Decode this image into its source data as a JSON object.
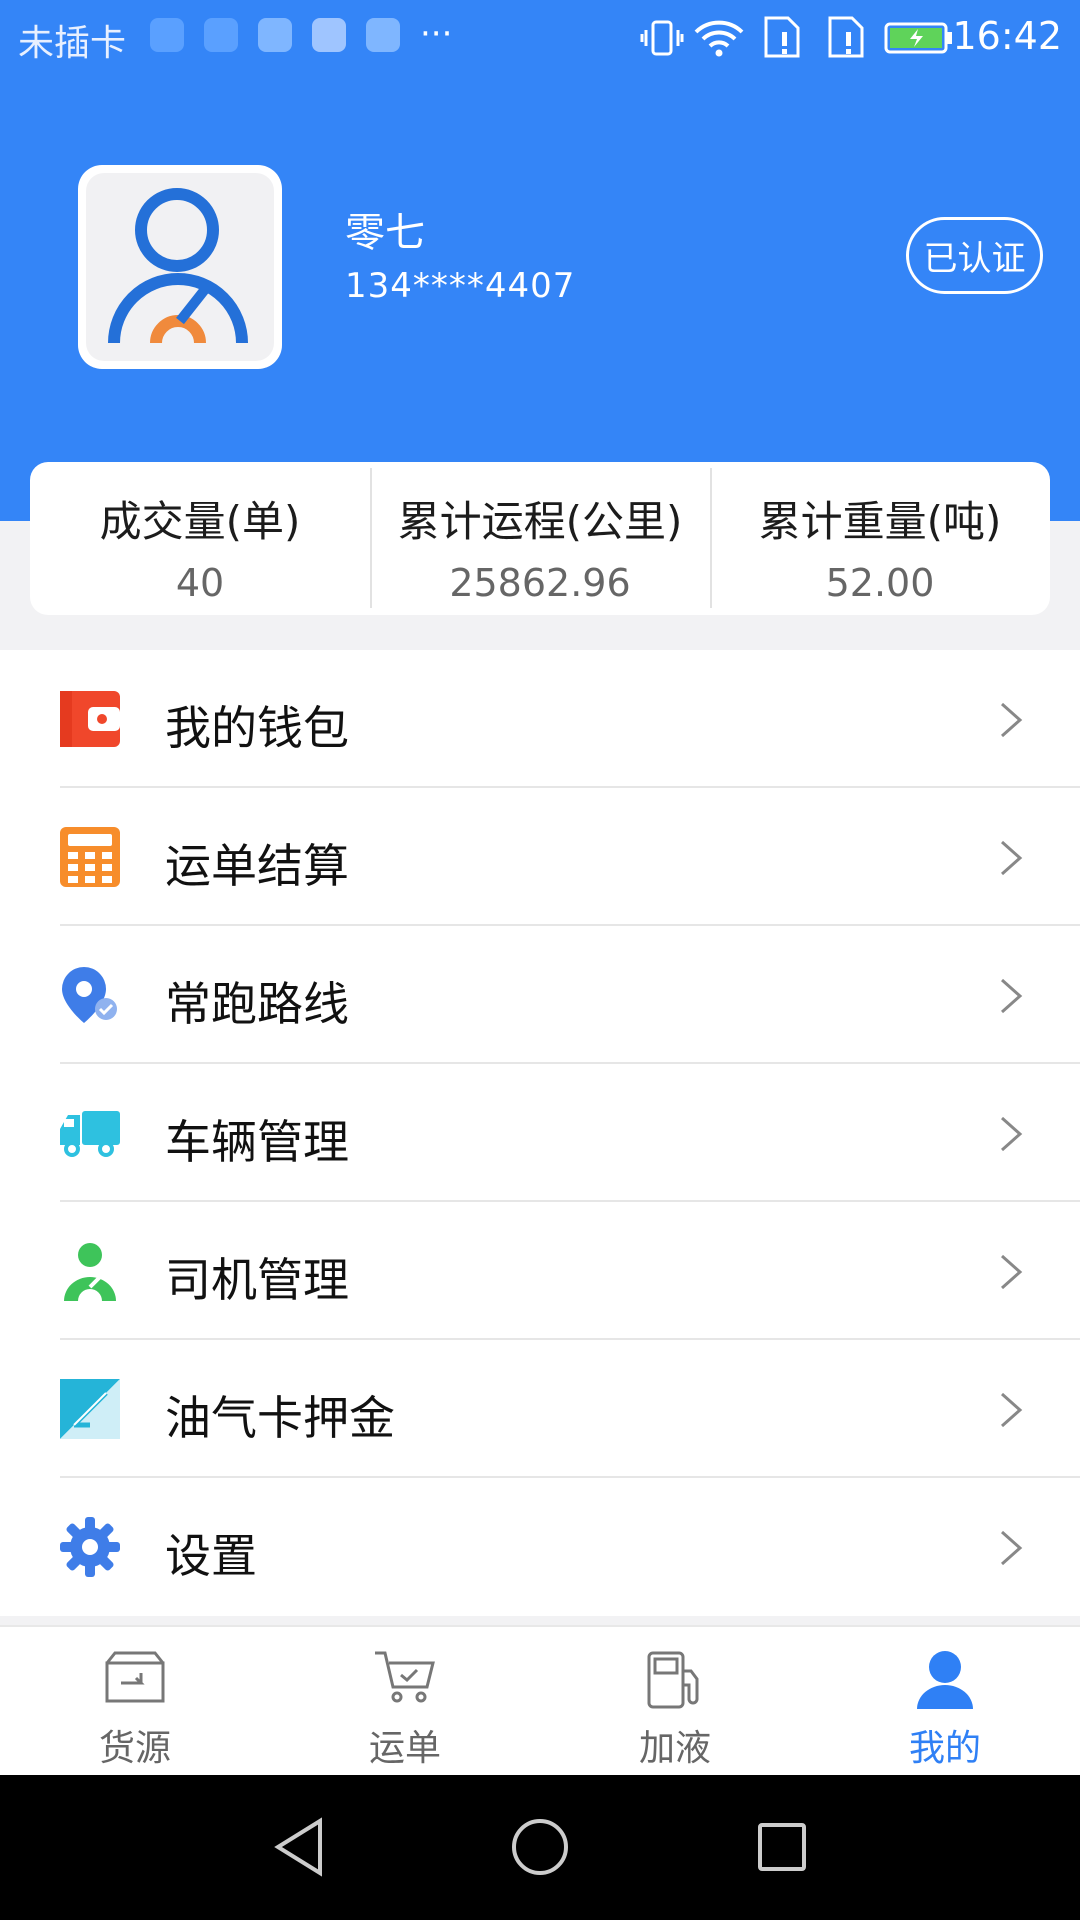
{
  "status_bar": {
    "carrier": "未插卡",
    "time": "16:42",
    "more": "···"
  },
  "profile": {
    "name": "零七",
    "phone": "134****4407",
    "badge": "已认证"
  },
  "stats": [
    {
      "label": "成交量(单)",
      "value": "40"
    },
    {
      "label": "累计运程(公里)",
      "value": "25862.96"
    },
    {
      "label": "累计重量(吨)",
      "value": "52.00"
    }
  ],
  "menu": [
    {
      "label": "我的钱包",
      "icon": "wallet-icon"
    },
    {
      "label": "运单结算",
      "icon": "calculator-icon"
    },
    {
      "label": "常跑路线",
      "icon": "route-pin-icon"
    },
    {
      "label": "车辆管理",
      "icon": "truck-icon"
    },
    {
      "label": "司机管理",
      "icon": "driver-icon"
    },
    {
      "label": "油气卡押金",
      "icon": "card-deposit-icon"
    },
    {
      "label": "设置",
      "icon": "gear-icon"
    }
  ],
  "bottom_nav": [
    {
      "label": "货源",
      "icon": "cargo-box-icon",
      "active": false
    },
    {
      "label": "运单",
      "icon": "cart-icon",
      "active": false
    },
    {
      "label": "加液",
      "icon": "fuel-pump-icon",
      "active": false
    },
    {
      "label": "我的",
      "icon": "user-icon",
      "active": true
    }
  ],
  "colors": {
    "primary": "#3485f7",
    "active_nav": "#2f80f5"
  }
}
